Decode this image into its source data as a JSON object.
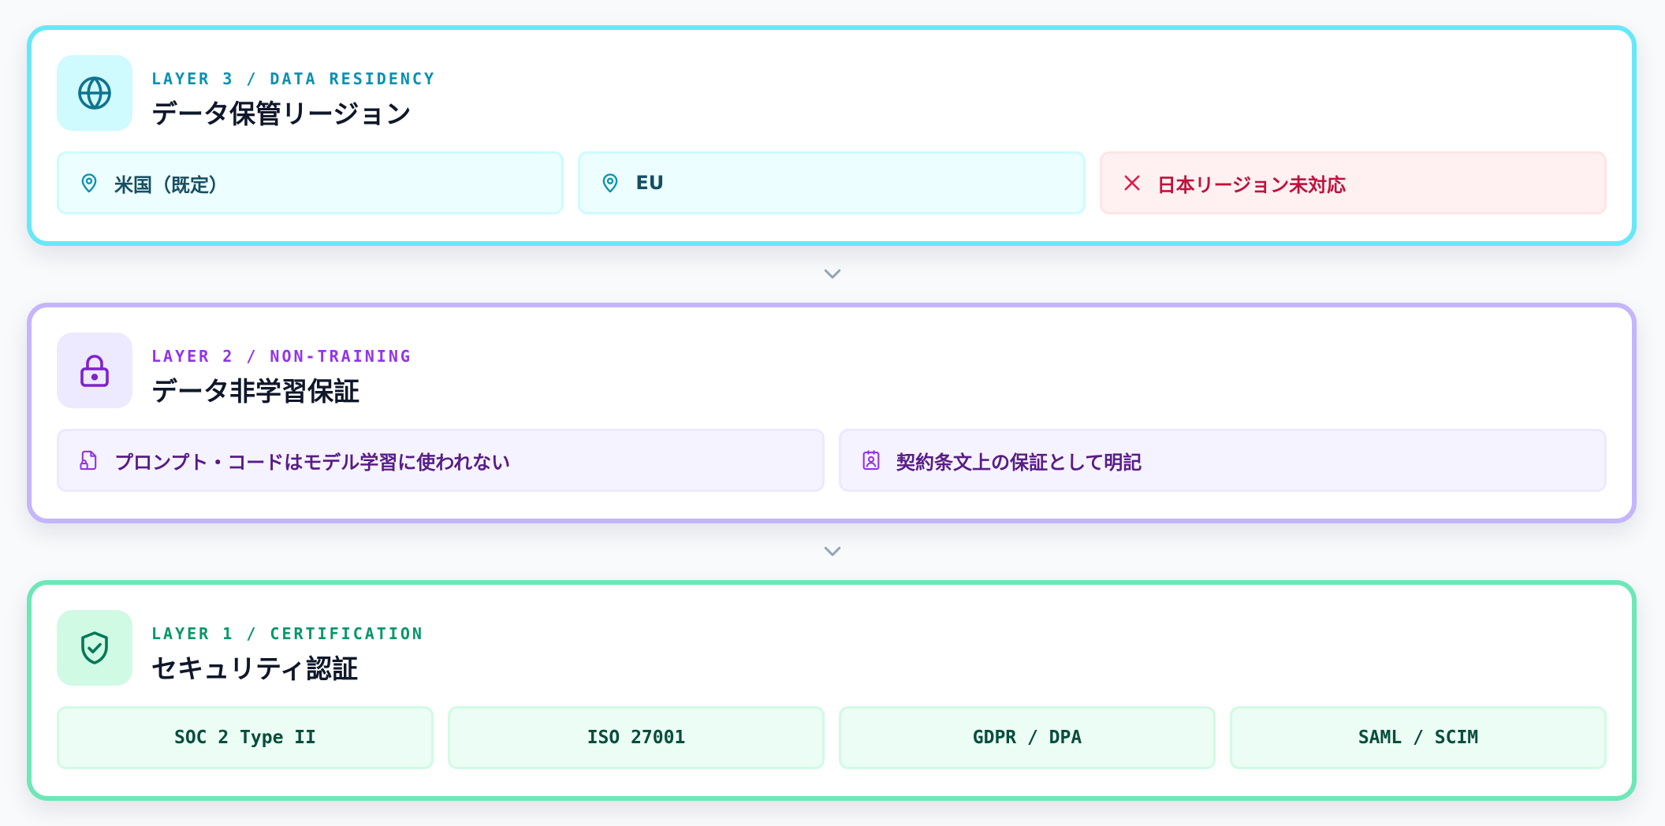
{
  "layers": [
    {
      "eyebrow": "LAYER 3 / DATA RESIDENCY",
      "title": "データ保管リージョン",
      "icon": "globe-icon",
      "accent": "#67e8f9",
      "chips": [
        {
          "label": "米国（既定）",
          "icon": "map-pin-icon"
        },
        {
          "label": "EU",
          "icon": "map-pin-icon"
        },
        {
          "label": "日本リージョン未対応",
          "icon": "x-icon",
          "status": "unsupported"
        }
      ]
    },
    {
      "eyebrow": "LAYER 2 / NON-TRAINING",
      "title": "データ非学習保証",
      "icon": "lock-icon",
      "accent": "#c4b5fd",
      "chips": [
        {
          "label": "プロンプト・コードはモデル学習に使われない",
          "icon": "file-lock-icon"
        },
        {
          "label": "契約条文上の保証として明記",
          "icon": "contract-icon"
        }
      ]
    },
    {
      "eyebrow": "LAYER 1 / CERTIFICATION",
      "title": "セキュリティ認証",
      "icon": "shield-check-icon",
      "accent": "#6ee7b7",
      "chips": [
        {
          "label": "SOC 2 Type II"
        },
        {
          "label": "ISO 27001"
        },
        {
          "label": "GDPR / DPA"
        },
        {
          "label": "SAML / SCIM"
        }
      ]
    }
  ],
  "connectors": [
    "chevron-down-icon",
    "chevron-down-icon"
  ]
}
